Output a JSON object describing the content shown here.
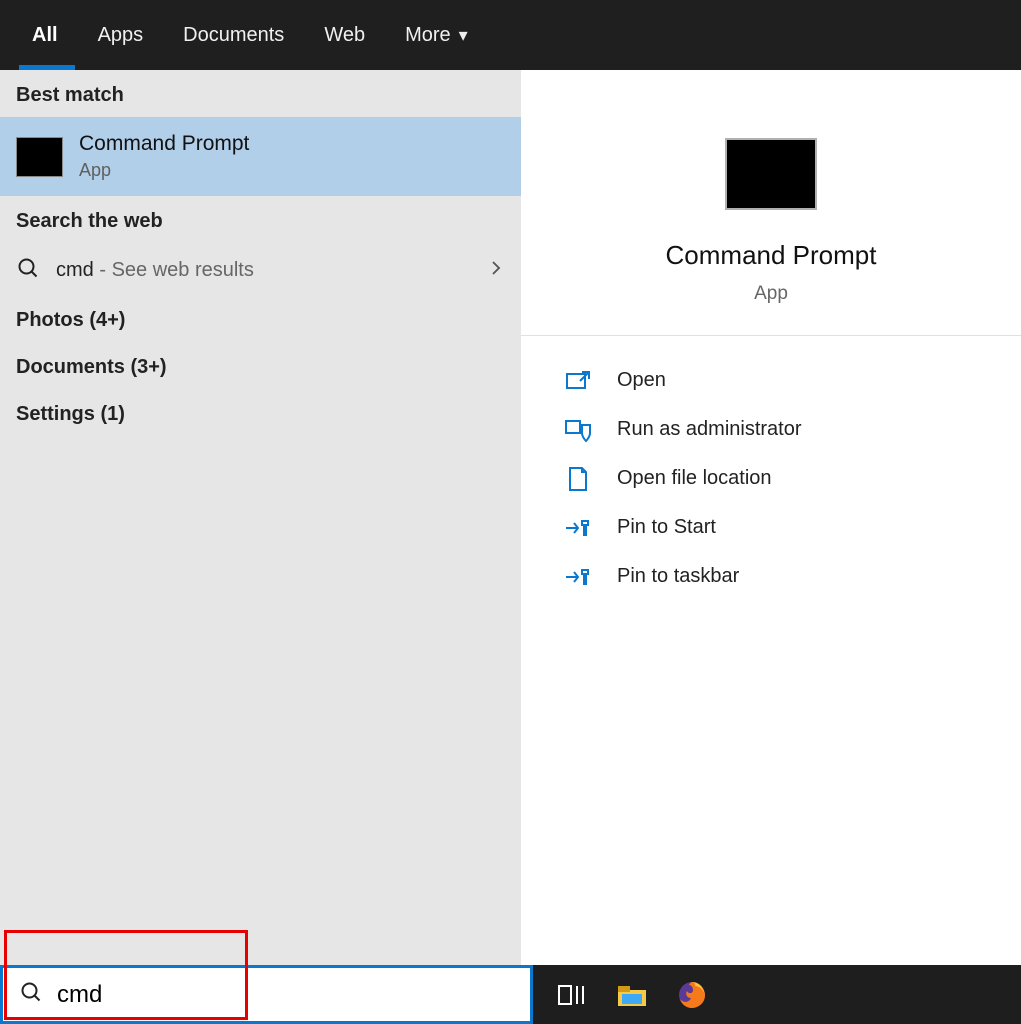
{
  "tabs": {
    "all": "All",
    "apps": "Apps",
    "documents": "Documents",
    "web": "Web",
    "more": "More"
  },
  "sections": {
    "best_match": "Best match",
    "search_web": "Search the web"
  },
  "best_result": {
    "title": "Command Prompt",
    "subtitle": "App"
  },
  "web_result": {
    "query": "cmd",
    "hint": " - See web results"
  },
  "categories": {
    "photos": "Photos (4+)",
    "documents": "Documents (3+)",
    "settings": "Settings (1)"
  },
  "preview": {
    "title": "Command Prompt",
    "subtitle": "App"
  },
  "actions": {
    "open": "Open",
    "run_admin": "Run as administrator",
    "open_loc": "Open file location",
    "pin_start": "Pin to Start",
    "pin_taskbar": "Pin to taskbar"
  },
  "search": {
    "value": "cmd"
  }
}
